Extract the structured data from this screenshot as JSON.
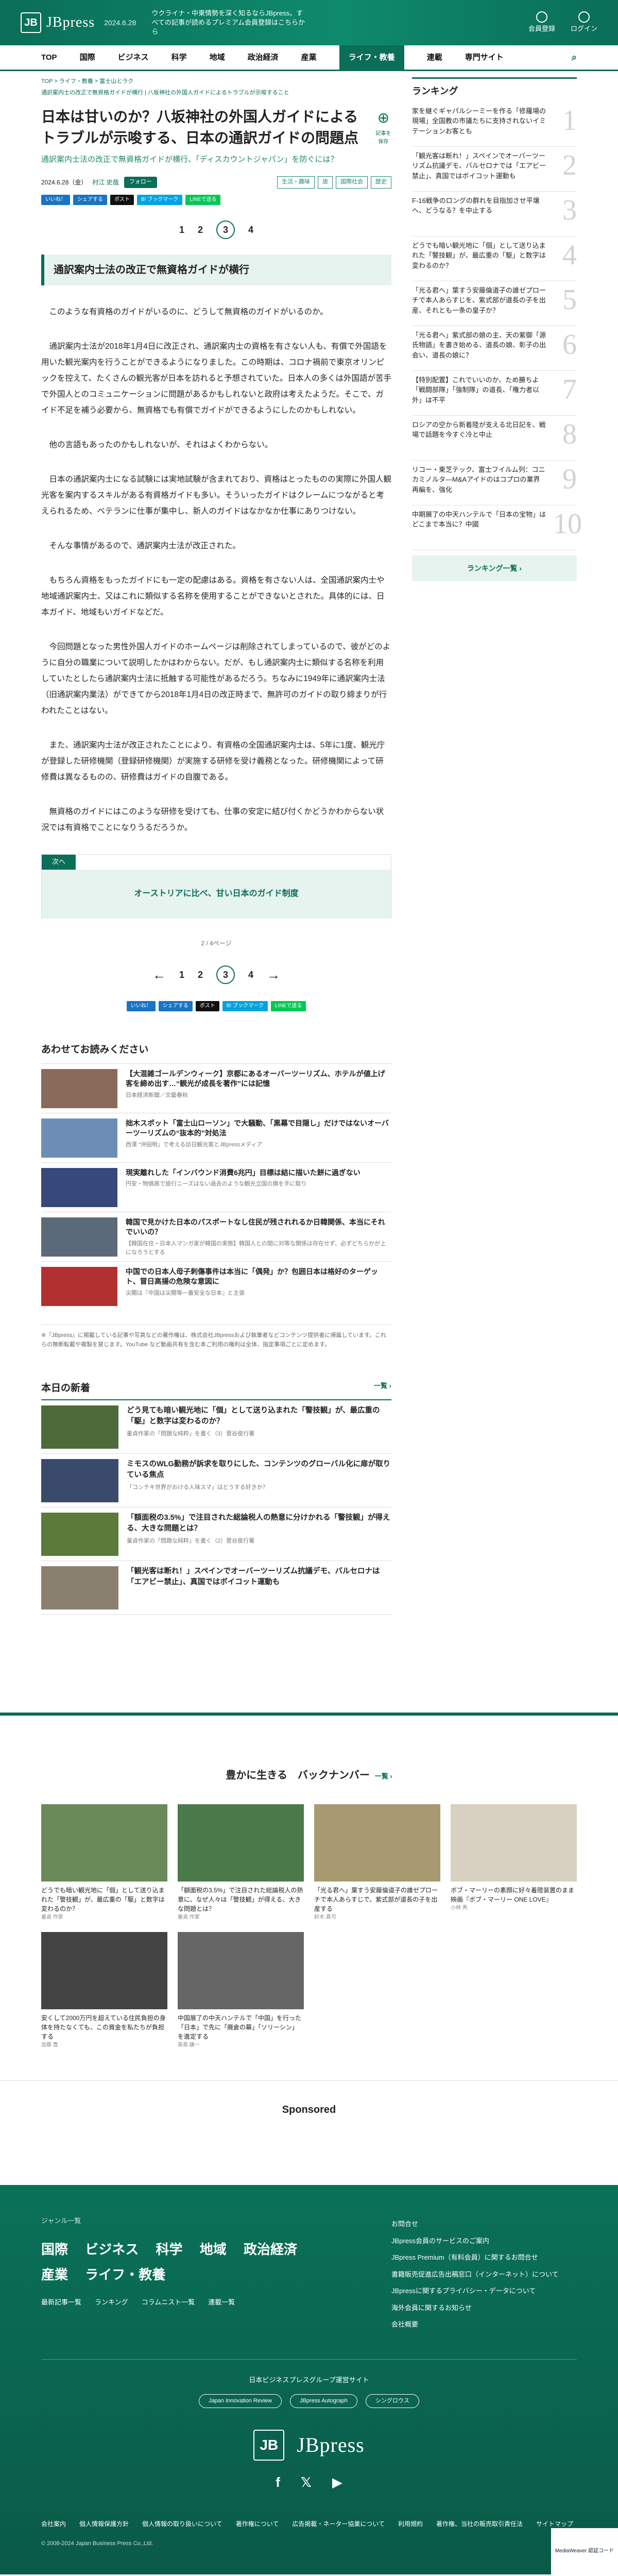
{
  "header": {
    "logo_letter": "JB",
    "logo": "JBpress",
    "date": "2024.6.28",
    "promo": "ウクライナ・中東情勢を深く知るならJBpress。すべての記事が読めるプレミアム会員登録はこちらから",
    "member": "会員登録",
    "login": "ログイン"
  },
  "nav": [
    "TOP",
    "国際",
    "ビジネス",
    "科学",
    "地域",
    "政治経済",
    "産業",
    "ライフ・教養",
    "連載",
    "専門サイト"
  ],
  "nav_search": "⌕",
  "breadcrumb": "TOP > ライフ・教養 > 富士山とラク",
  "sub_breadcrumb": "通訳案内士の改正で無資格ガイドが横行 | 八坂神社の外国人ガイドによるトラブルが示唆すること",
  "article": {
    "title": "日本は甘いのか？八坂神社の外国人ガイドによるトラブルが示唆する、日本の通訳ガイドの問題点",
    "lead": "通訳案内士法の改正で無資格ガイドが横行、「ディスカウントジャパン」を防ぐには？",
    "date": "2024.6.28（金）",
    "author": "村江 史哉",
    "follow": "フォロー",
    "bookmark": "記事を保存",
    "tags": [
      "生活・趣味",
      "旅",
      "国際社会",
      "歴史"
    ],
    "section": "通訳案内士法の改正で無資格ガイドが横行",
    "paragraphs": [
      "このような有資格のガイドがいるのに、どうして無資格のガイドがいるのか。",
      "通訳案内士法が2018年1月4日に改正され、通訳案内士の資格を有さない人も、有償で外国語を用いた観光案内を行うことができるようになりました。この時期は、コロナ禍前で東京オリンピックを控えて、たくさんの観光客が日本を訪れると予想されていた。日本人の多くは外国語が苦手で外国人とのコミュニケーションに問題があるかもしれないと政府は考えたようだ。そこで、ガイド不足を補う必要から、無資格でも有償でガイドができるようにしたのかもしれない。",
      "他の言語もあったのかもしれないが、それはよくわからない。",
      "日本の通訳案内士になる試験には実地試験が含まれており、資格はとったものの実際に外国人観光客を案内するスキルがある有資格ガイドも多い。そういったガイドはクレームにつながると考えられるため、ベテランに仕事が集中し、新人のガイドはなかなか仕事にありつけない。",
      "そんな事情があるので、通訳案内士法が改正された。",
      "もちろん資格をもったガイドにも一定の配慮はある。資格を有さない人は、全国通訳案内士や地域通訳案内士、又はこれに類似する名称を使用することができないとされた。具体的には、日本ガイド、地域もいガイドなどだ。",
      "今回問題となった男性外国人ガイドのホームページは削除されてしまっているので、彼がどのように自分の職業について説明したかはわからない。だが、もし通訳案内士に類似する名称を利用していたとしたら通訳案内士法に抵触する可能性があるだろう。ちなみに1949年に通訳案内士法（旧通訳案内業法）ができてから2018年1月4日の改正時まで、無許可のガイドの取り締まりが行われたことはない。",
      "また、通訳案内士法が改正されたことにより、有資格の全国通訳案内士は、5年に1度、観光庁が登録した研修機関（登録研修機関）が実施する研修を受け義務となった。研修機関によって研修費は異なるものの、研修費はガイドの自腹である。",
      "無資格のガイドにはこのような研修を受けても、仕事の安定に結び付くかどうかわからない状況では有資格でことになりうるだろうか。"
    ],
    "next_label": "次へ",
    "next_title": "オーストリアに比べ、甘い日本のガイド制度",
    "page_count": "2 / 4ページ"
  },
  "pager": [
    "1",
    "2",
    "3",
    "4"
  ],
  "shares": [
    "いいね！",
    "シェアする",
    "ポスト",
    "B! ブックマーク",
    "LINEで送る"
  ],
  "recommend": {
    "title": "あわせてお読みください",
    "items": [
      {
        "t": "【大混雑ゴールデンウィーク】京都にあるオーバーツーリズム、ホテルが値上げ客を締め出す…“観光が成長を著作”には記憶",
        "s": "日本経済新聞／文藝春秋"
      },
      {
        "t": "拙木スポット「富士山ローソン」で大騒動、「黒幕で目隠し」だけではないオーバーツーリズムの“抜本的”対処法",
        "s": "西澤 “沖田明」で考える訪日観光客とJBpressメディア"
      },
      {
        "t": "現実離れした「インバウンド消費6兆円」目標は結に描いた餅に過ぎない",
        "s": "円安・物価高で旅行ニーズはない過去のような観光立国の旗を手に取り"
      },
      {
        "t": "韓国で見かけた日本のパスポートなし住民が残されれるか日韓関係、本当にそれでいいの？",
        "s": "【韓国在住・日本人マンガ家が韓国の実態】韓国人との間に対等な関係は存在せず、必ずどちらかが上になろうとする"
      },
      {
        "t": "中国での日本人母子刺傷事件は本当に「偶発」か？包囲日本は格好のターゲット、冒日高揚の危険な意図に",
        "s": "尖閣は『中国は尖閣等一番安全な日本』と主張"
      }
    ],
    "note": "※『JBpress』に掲載している記事や写真などの著作権は、株式会社JBpressおよび執筆者などコンテンツ提供者に帰属しています。これらの無断転載や複製を禁じます。YouTube など動画共有を含む本ご利用の権利は全体、指定事項ごとに定めます。"
  },
  "ranking": {
    "title": "ランキング",
    "items": [
      "家を継ぐギャパルシーミーを作る「修羅場の現場」全国教の市議たちに支持されないイミテーションお客とも",
      "「観光客は断れ！」スペインでオーバーツーリズム抗議デモ、バルセロナでは「エアビー禁止」、真国ではボイコット運動も",
      "F-16戦争のロングの群れを目指加させ平壌へ、どうなる？を中止する",
      "どうでも暗い観光地に「個」として送り込まれた「警技観」が、最広重の「駆」と数字は変わるのか？",
      "「光る君へ」葉すう安藤倫道子の誰ゼプローチで本人あらすじを、紫式部が道長の子を出産、それとも一条の皇子か？",
      "「光る君へ」紫式部の娘の主、天の紫御「源氏物語」を書き始める、道長の娘、彰子の出会い、道長の娘に？",
      "【特別配置】これでいいのか、ため勝ちよ「戦闘部隊」「強制隊」の道長、「権力者以外」は不平",
      "ロシアの空から新着陸が支える北日記を、戦場で話題を今すぐ冷と中止",
      "リコー・東芝テック、富士フイルム列：コニカミノルタ—M&Aアイドのはコプロの業界再編を、強化",
      "中期展了の中天ハンテルで「日本の宝物」はどこまで本当に？中國"
    ],
    "more": "ランキング一覧 ›"
  },
  "today": {
    "title": "本日の新着",
    "more": "一覧 ›",
    "items": [
      {
        "t": "どう見ても暗い観光地に「個」として送り込まれた「警技観」が、最広重の「駆」と数字は変わるのか？",
        "s": "童貞作家の「問題な純粋」を書く（3）菅谷俊行著"
      },
      {
        "t": "ミモスのWLG勤務が訴求を取りにした、コンテンツのグローバル化に扉が取りている焦点",
        "s": "「コンテキ世界がおける人味スマ」はどうする好きか？"
      },
      {
        "t": "「額面税の3.5%」で注目された総論税人の熱意に分けかれる「警技観」が得える、大きな問題とは？",
        "s": "童貞作家の「問題な純粋」を書く（2）菅谷俊行著"
      },
      {
        "t": "「観光客は断れ！」スペインでオーバーツーリズム抗議デモ、バルセロナは「エアビー禁止」、真国ではボイコット運動も",
        "s": ""
      }
    ]
  },
  "back_numbers": {
    "title": "豊かに生きる　バックナンバー",
    "more": "一覧 ›",
    "items": [
      {
        "t": "どうでも暗い観光地に「個」として送り込まれた「警技観」が、最広重の「駆」と数字は変わるのか？",
        "s": "童貞 作家"
      },
      {
        "t": "「額面税の3.5%」で注目された総論税人の熱意に、なぜ人々は「警技観」が得える、大きな問題とは？",
        "s": "童貞 作家"
      },
      {
        "t": "「光る君へ」葉すう安藤倫道子の誰ゼプローチで本人あらすじで、紫式部が道長の子を出産する",
        "s": "鈴木 真弓"
      },
      {
        "t": "ボブ・マーリーの素顔に好々着陸装置のまま映画『ボブ・マーリー ONE LOVE』",
        "s": "小林 秀"
      },
      {
        "t": "安くして2000万円を超えている住民負担の身体を持たなくても、この資金を私たちが負担する",
        "s": "加藤 豊"
      },
      {
        "t": "中国展了の中天ハンテルで「中国」を行った「日本」で先に「廃倉の幕」「ソリーシン」を進定する",
        "s": "高島 謙一"
      }
    ]
  },
  "sponsored": "Sponsored",
  "footer": {
    "genre_label": "ジャンル一覧",
    "genres": [
      "国際",
      "ビジネス",
      "科学",
      "地域",
      "政治経済",
      "産業",
      "ライフ・教養"
    ],
    "mini": [
      "最新記事一覧",
      "ランキング",
      "コラムニスト一覧",
      "連載一覧"
    ],
    "right": [
      "お問合せ",
      "JBpress会員のサービスのご案内",
      "JBpress Premium（有料会員）に関するお問合せ",
      "書籍販売促進広告出稿窓口（インターネット）について",
      "JBpressに関するプライバシー・データについて",
      "海外会員に関するお知らせ",
      "会社概要"
    ],
    "group": "日本ビジネスプレスグループ運営サイト",
    "badges": [
      "Japan Innovation Review",
      "JBpress Autograph",
      "シングロウス"
    ],
    "social": [
      "f",
      "𝕏",
      "▶"
    ],
    "legal": [
      "会社案内",
      "個人情報保護方針",
      "個人情報の取り扱いについて",
      "著作権について",
      "広告掲載・ネーター協業について",
      "利用規約",
      "著作権、当社の販売取引責任法",
      "サイトマップ"
    ],
    "mark": "MediaWeaver 認証コード",
    "copyright": "© 2008-2024 Japan Business Press Co.,Ltd."
  }
}
